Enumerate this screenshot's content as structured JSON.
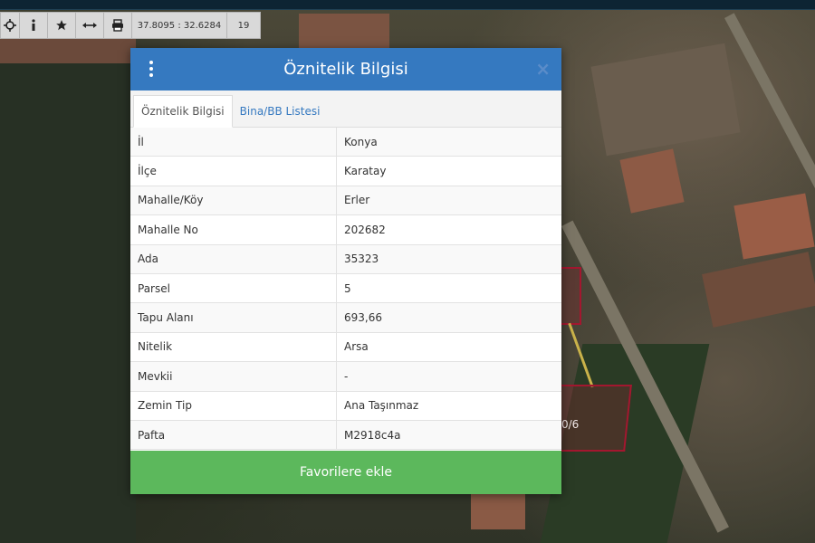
{
  "toolbar": {
    "coordinates": "37.8095 : 32.6284",
    "zoom": "19",
    "icons": [
      "crosshair-icon",
      "info-icon",
      "star-icon",
      "measure-icon",
      "print-icon"
    ]
  },
  "map": {
    "parcel_label": "0/6"
  },
  "modal": {
    "title": "Öznitelik Bilgisi",
    "close_label": "×",
    "tabs": [
      {
        "label": "Öznitelik Bilgisi",
        "active": true
      },
      {
        "label": "Bina/BB Listesi",
        "active": false
      }
    ],
    "rows": [
      {
        "key": "İl",
        "value": "Konya"
      },
      {
        "key": "İlçe",
        "value": "Karatay"
      },
      {
        "key": "Mahalle/Köy",
        "value": "Erler"
      },
      {
        "key": "Mahalle No",
        "value": "202682"
      },
      {
        "key": "Ada",
        "value": "35323"
      },
      {
        "key": "Parsel",
        "value": "5"
      },
      {
        "key": "Tapu Alanı",
        "value": "693,66"
      },
      {
        "key": "Nitelik",
        "value": "Arsa"
      },
      {
        "key": "Mevkii",
        "value": "-"
      },
      {
        "key": "Zemin Tip",
        "value": "Ana Taşınmaz"
      },
      {
        "key": "Pafta",
        "value": "M2918c4a"
      }
    ],
    "action_button": "Favorilere ekle"
  },
  "colors": {
    "header_blue": "#3579c0",
    "button_green": "#5cb85c",
    "parcel_outline": "#a3172f"
  }
}
